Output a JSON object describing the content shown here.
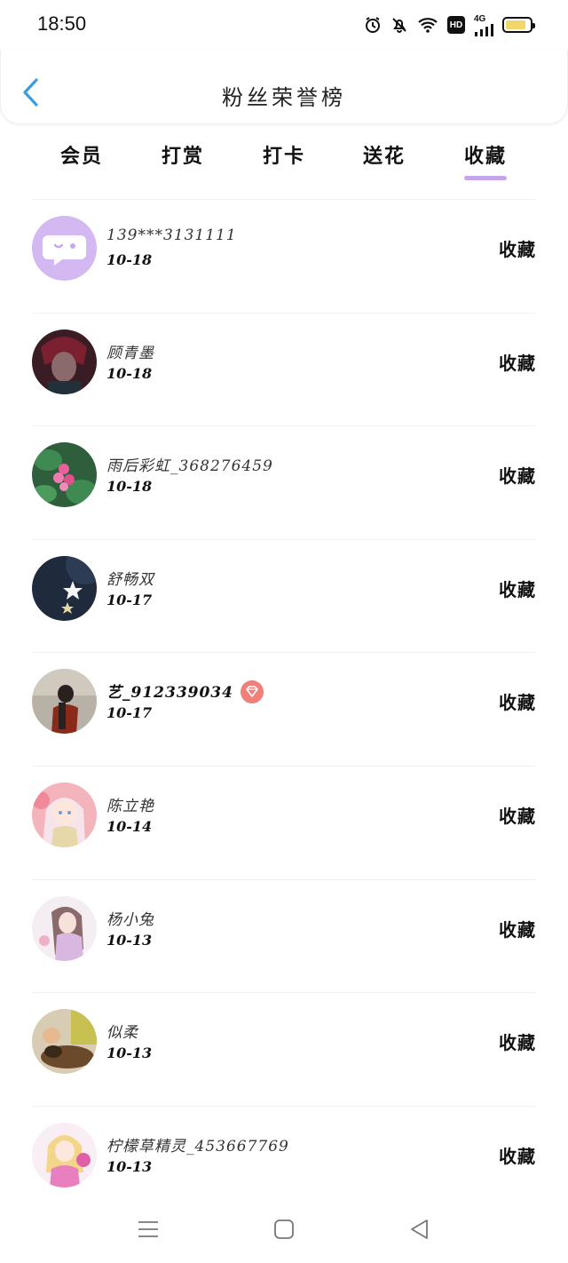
{
  "status_bar": {
    "time": "18:50",
    "icons": [
      "alarm-icon",
      "mute-icon",
      "wifi-icon",
      "hd-icon",
      "signal-icon",
      "battery-icon"
    ],
    "hd_label": "HD",
    "network_label": "4G",
    "battery_level": 0.85,
    "battery_color": "#f2d66a"
  },
  "header": {
    "back_icon": "chevron-left-icon",
    "title": "粉丝荣誉榜"
  },
  "tabs": {
    "items": [
      {
        "label": "会员"
      },
      {
        "label": "打赏"
      },
      {
        "label": "打卡"
      },
      {
        "label": "送花"
      },
      {
        "label": "收藏"
      }
    ],
    "active_index": 4,
    "indicator_color": "#c4a6e8"
  },
  "list": {
    "items": [
      {
        "name": "139***3131111",
        "date": "10-18",
        "action": "收藏",
        "avatar": "default-chat-avatar"
      },
      {
        "name": "顾青墨",
        "date": "10-18",
        "action": "收藏",
        "avatar": "photo-avatar"
      },
      {
        "name": "雨后彩虹_368276459",
        "date": "10-18",
        "action": "收藏",
        "avatar": "flower-avatar"
      },
      {
        "name": "舒畅双",
        "date": "10-17",
        "action": "收藏",
        "avatar": "star-avatar"
      },
      {
        "name": "艺_912339034",
        "date": "10-17",
        "action": "收藏",
        "avatar": "photo-avatar",
        "badge": "diamond-icon"
      },
      {
        "name": "陈立艳",
        "date": "10-14",
        "action": "收藏",
        "avatar": "anime-girl-avatar"
      },
      {
        "name": "杨小兔",
        "date": "10-13",
        "action": "收藏",
        "avatar": "anime-girl-avatar"
      },
      {
        "name": "似柔",
        "date": "10-13",
        "action": "收藏",
        "avatar": "pet-avatar"
      },
      {
        "name": "柠檬草精灵_453667769",
        "date": "10-13",
        "action": "收藏",
        "avatar": "anime-girl-avatar"
      }
    ]
  },
  "nav_bar": {
    "icons": [
      "menu-icon",
      "home-icon",
      "back-triangle-icon"
    ]
  }
}
